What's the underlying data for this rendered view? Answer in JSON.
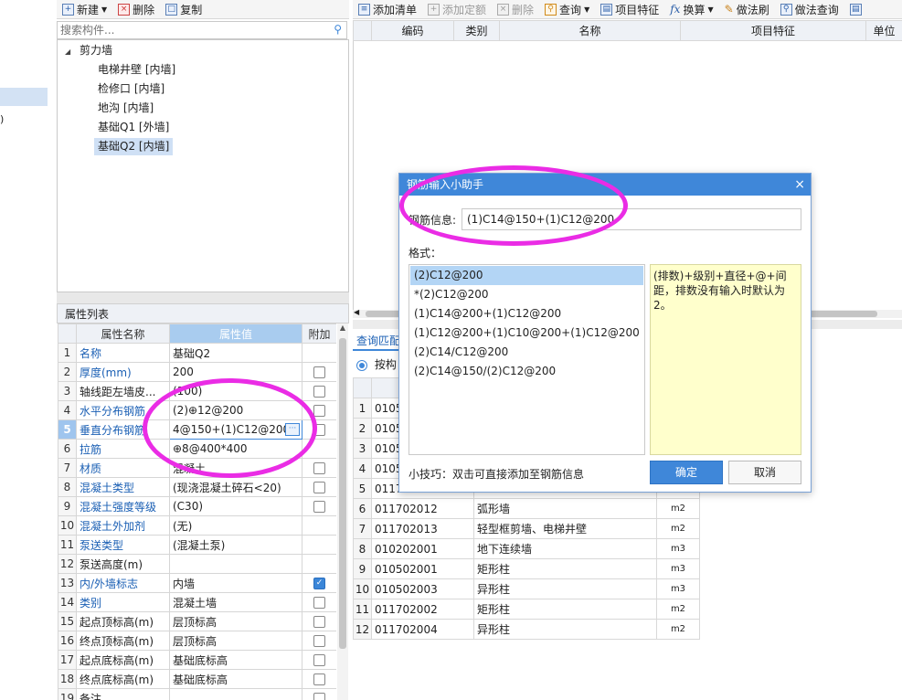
{
  "left_toolbar": {
    "new": "新建",
    "delete": "删除",
    "copy": "复制"
  },
  "search": {
    "placeholder": "搜索构件..."
  },
  "tree": {
    "root": "剪力墙",
    "items": [
      "电梯井壁 [内墙]",
      "检修口 [内墙]",
      "地沟 [内墙]",
      "基础Q1 [外墙]",
      "基础Q2 [内墙]"
    ]
  },
  "far_left": {
    "fragment": ")"
  },
  "props": {
    "title": "属性列表",
    "headers": {
      "name": "属性名称",
      "value": "属性值",
      "extra": "附加"
    },
    "rows": [
      {
        "n": "1",
        "name": "名称",
        "value": "基础Q2",
        "check": "none"
      },
      {
        "n": "2",
        "name": "厚度(mm)",
        "value": "200",
        "check": "off"
      },
      {
        "n": "3",
        "name": "轴线距左墙皮...",
        "value": "(100)",
        "check": "off"
      },
      {
        "n": "4",
        "name": "水平分布钢筋",
        "value": "(2)⊕12@200",
        "check": "off"
      },
      {
        "n": "5",
        "name": "垂直分布钢筋",
        "value": "4@150+(1)C12@200",
        "check": "off"
      },
      {
        "n": "6",
        "name": "拉筋",
        "value": "⊕8@400*400",
        "check": "none"
      },
      {
        "n": "7",
        "name": "材质",
        "value": "混凝土",
        "check": "off"
      },
      {
        "n": "8",
        "name": "混凝土类型",
        "value": "(现浇混凝土碎石<20)",
        "check": "off"
      },
      {
        "n": "9",
        "name": "混凝土强度等级",
        "value": "(C30)",
        "check": "off"
      },
      {
        "n": "10",
        "name": "混凝土外加剂",
        "value": "(无)",
        "check": "none"
      },
      {
        "n": "11",
        "name": "泵送类型",
        "value": "(混凝土泵)",
        "check": "none"
      },
      {
        "n": "12",
        "name": "泵送高度(m)",
        "value": "",
        "check": "none"
      },
      {
        "n": "13",
        "name": "内/外墙标志",
        "value": "内墙",
        "check": "on"
      },
      {
        "n": "14",
        "name": "类别",
        "value": "混凝土墙",
        "check": "off"
      },
      {
        "n": "15",
        "name": "起点顶标高(m)",
        "value": "层顶标高",
        "check": "off"
      },
      {
        "n": "16",
        "name": "终点顶标高(m)",
        "value": "层顶标高",
        "check": "off"
      },
      {
        "n": "17",
        "name": "起点底标高(m)",
        "value": "基础底标高",
        "check": "off"
      },
      {
        "n": "18",
        "name": "终点底标高(m)",
        "value": "基础底标高",
        "check": "off"
      },
      {
        "n": "19",
        "name": "备注",
        "value": "",
        "check": "off"
      }
    ]
  },
  "right_toolbar": {
    "add_list": "添加清单",
    "add_quota": "添加定额",
    "delete": "删除",
    "query": "查询",
    "feature": "项目特征",
    "calc": "换算",
    "method_brush": "做法刷",
    "method_query": "做法查询"
  },
  "list_headers": {
    "code": "编码",
    "type": "类别",
    "name": "名称",
    "feature": "项目特征",
    "unit": "单位"
  },
  "lower": {
    "tab": "查询匹配",
    "radio_label": "按构",
    "rows": [
      {
        "n": "1",
        "code": "0105",
        "name": "",
        "unit": ""
      },
      {
        "n": "2",
        "code": "0105",
        "name": "",
        "unit": ""
      },
      {
        "n": "3",
        "code": "0105",
        "name": "",
        "unit": ""
      },
      {
        "n": "4",
        "code": "0105",
        "name": "",
        "unit": ""
      },
      {
        "n": "5",
        "code": "0117",
        "name": "",
        "unit": ""
      },
      {
        "n": "6",
        "code": "011702012",
        "name": "弧形墙",
        "unit": "m2"
      },
      {
        "n": "7",
        "code": "011702013",
        "name": "轻型框剪墙、电梯井壁",
        "unit": "m2"
      },
      {
        "n": "8",
        "code": "010202001",
        "name": "地下连续墙",
        "unit": "m3"
      },
      {
        "n": "9",
        "code": "010502001",
        "name": "矩形柱",
        "unit": "m3"
      },
      {
        "n": "10",
        "code": "010502003",
        "name": "异形柱",
        "unit": "m3"
      },
      {
        "n": "11",
        "code": "011702002",
        "name": "矩形柱",
        "unit": "m2"
      },
      {
        "n": "12",
        "code": "011702004",
        "name": "异形柱",
        "unit": "m2"
      }
    ]
  },
  "dialog": {
    "title": "钢筋输入小助手",
    "close": "×",
    "info_label": "钢筋信息:",
    "info_value": "(1)C14@150+(1)C12@200",
    "format_label": "格式：",
    "formats": [
      "(2)C12@200",
      "*(2)C12@200",
      "(1)C14@200+(1)C12@200",
      "(1)C12@200+(1)C10@200+(1)C12@200",
      "(2)C14/C12@200",
      "(2)C14@150/(2)C12@200"
    ],
    "hint": "(排数)+级别+直径+@+间距，排数没有输入时默认为2。",
    "tip": "小技巧：双击可直接添加至钢筋信息",
    "ok": "确定",
    "cancel": "取消"
  },
  "colors": {
    "accent": "#3f87d9",
    "annotation": "#ea2ce5",
    "hint_bg": "#ffffcc"
  }
}
